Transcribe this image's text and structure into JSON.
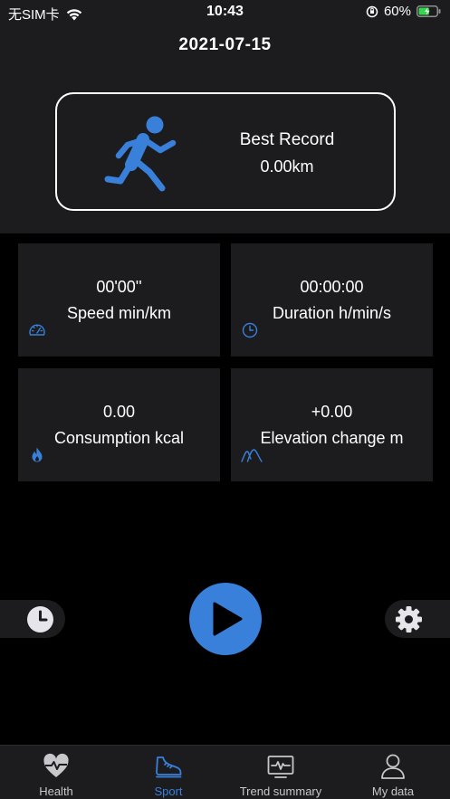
{
  "status_bar": {
    "carrier": "无SIM卡",
    "time": "10:43",
    "battery_percent": "60%",
    "battery_level": 0.6
  },
  "header": {
    "date": "2021-07-15",
    "record": {
      "title": "Best Record",
      "value": "0.00km"
    }
  },
  "stats": [
    {
      "value": "00'00''",
      "label": "Speed min/km",
      "icon": "speedometer-icon"
    },
    {
      "value": "00:00:00",
      "label": "Duration h/min/s",
      "icon": "clock-icon"
    },
    {
      "value": "0.00",
      "label": "Consumption kcal",
      "icon": "flame-icon"
    },
    {
      "value": "+0.00",
      "label": "Elevation change m",
      "icon": "mountain-icon"
    }
  ],
  "controls": {
    "history_icon": "history-clock-icon",
    "start_icon": "play-icon",
    "settings_icon": "gear-icon"
  },
  "tabbar": {
    "items": [
      {
        "label": "Health",
        "icon": "heart-pulse-icon",
        "active": false
      },
      {
        "label": "Sport",
        "icon": "sneaker-icon",
        "active": true
      },
      {
        "label": "Trend summary",
        "icon": "monitor-pulse-icon",
        "active": false
      },
      {
        "label": "My data",
        "icon": "person-icon",
        "active": false
      }
    ]
  },
  "colors": {
    "accent": "#3880d9",
    "background": "#000000",
    "panel": "#1c1c1e"
  }
}
